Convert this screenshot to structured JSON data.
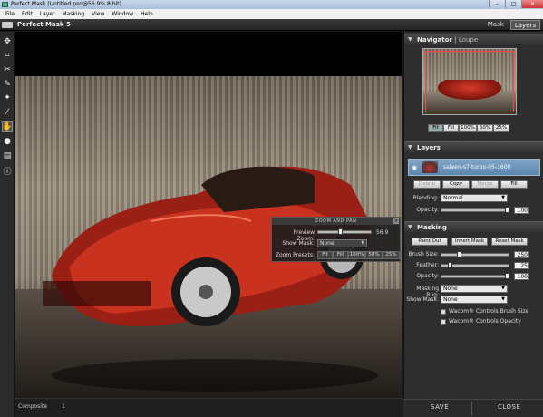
{
  "window": {
    "title": "Perfect Mask (Untitled.psd@56.9% 8 bit)"
  },
  "menu": [
    "File",
    "Edit",
    "Layer",
    "Masking",
    "View",
    "Window",
    "Help"
  ],
  "app": {
    "name": "Perfect Mask 5",
    "tabs": [
      "Mask",
      "Layers"
    ],
    "active_tab": "Layers"
  },
  "tools": [
    "move-icon",
    "crop-icon",
    "scissors-icon",
    "brush-icon",
    "magic-brush-icon",
    "eyedropper-icon",
    "hand-icon",
    "zoom-icon",
    "toggle-view-icon",
    "info-icon"
  ],
  "zoom_panel": {
    "title": "ZOOM AND PAN",
    "preview_zoom_label": "Preview Zoom:",
    "preview_zoom_value": "56.9",
    "show_mask_label": "Show Mask:",
    "show_mask_value": "None",
    "presets_label": "Zoom Presets:",
    "presets": [
      "Fit",
      "Fill",
      "100%",
      "50%",
      "25%"
    ]
  },
  "navigator": {
    "title": "Navigator",
    "alt_tab": "Loupe",
    "buttons": [
      "Fit",
      "Fill",
      "100%",
      "50%",
      "25%"
    ]
  },
  "layers": {
    "title": "Layers",
    "item_name": "saleen-s7-turbo-05-1600",
    "buttons": [
      "Delete",
      "Copy",
      "Merge",
      "Fill"
    ],
    "blending_label": "Blending:",
    "blending_value": "Normal",
    "opacity_label": "Opacity:",
    "opacity_value": "100"
  },
  "masking": {
    "title": "Masking",
    "buttons": [
      "Paint Out",
      "Invert Mask",
      "Reset Mask"
    ],
    "brush_size_label": "Brush Size:",
    "brush_size_value": "250",
    "feather_label": "Feather:",
    "feather_value": "25",
    "opacity_label": "Opacity:",
    "opacity_value": "100",
    "masking_bug_label": "Masking Bug:",
    "masking_bug_value": "None",
    "show_mask_label": "Show Mask:",
    "show_mask_value": "None",
    "wacom_brush": "Wacom® Controls Brush Size",
    "wacom_opacity": "Wacom® Controls Opacity"
  },
  "status": {
    "label": "Composite",
    "value": "1"
  },
  "footer": {
    "save": "SAVE",
    "close": "CLOSE"
  }
}
